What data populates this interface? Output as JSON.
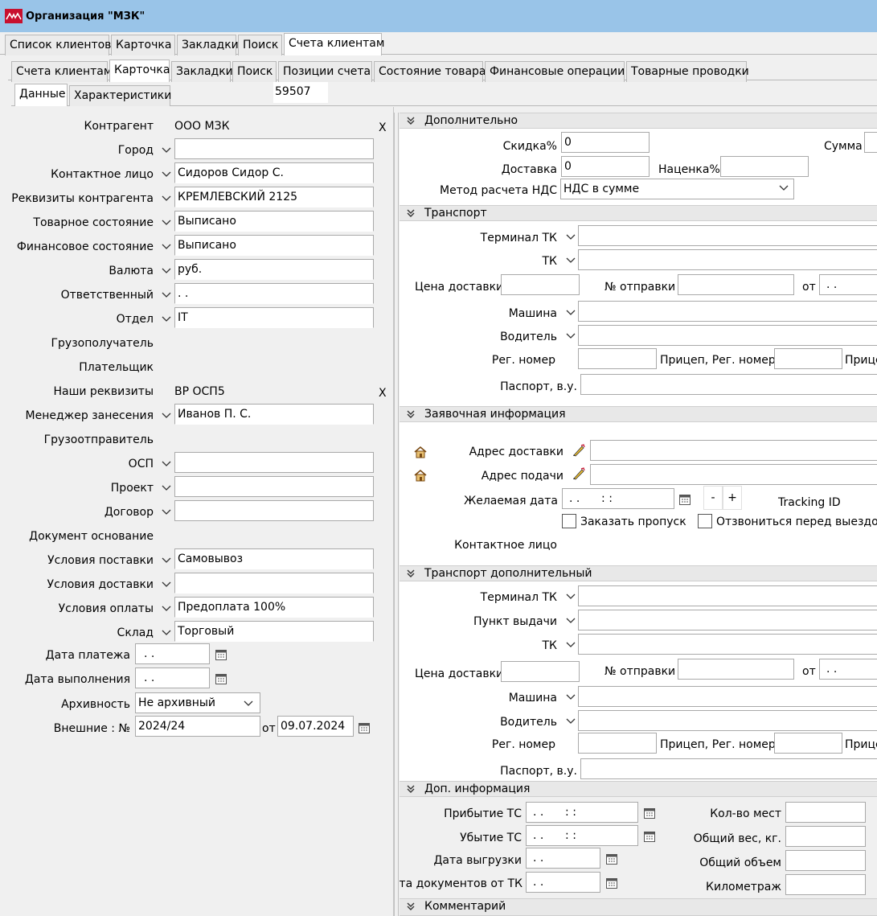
{
  "window": {
    "title": "Организация \"МЗК\""
  },
  "tabs_main": [
    "Список клиентов",
    "Карточка",
    "Закладки",
    "Поиск",
    "Счета клиентам"
  ],
  "tabs_sub": [
    "Счета клиентам",
    "Карточка",
    "Закладки",
    "Поиск",
    "Позиции счета",
    "Состояние товара",
    "Финансовые операции",
    "Товарные проводки"
  ],
  "tabs_inner": [
    "Данные",
    "Характеристики"
  ],
  "record_id": "59507",
  "left": {
    "kontragent_label": "Контрагент",
    "kontragent_value": "ООО МЗК",
    "kontragent_clear": "X",
    "gorod_label": "Город",
    "gorod_value": "",
    "contact_label": "Контактное лицо",
    "contact_value": "Сидоров Сидор С.",
    "rekv_label": "Реквизиты контрагента",
    "rekv_value": "КРЕМЛЕВСКИЙ 2125",
    "tov_label": "Товарное состояние",
    "tov_value": "Выписано",
    "fin_label": "Финансовое состояние",
    "fin_value": "Выписано",
    "val_label": "Валюта",
    "val_value": "руб.",
    "otv_label": "Ответственный",
    "otv_value": ". .",
    "otdel_label": "Отдел",
    "otdel_value": "IT",
    "gruzopol_label": "Грузополучатель",
    "plat_label": "Плательщик",
    "nashi_label": "Наши реквизиты",
    "nashi_value": "ВР ОСП5",
    "nashi_clear": "X",
    "manager_label": "Менеджер занесения",
    "manager_value": "Иванов П. С.",
    "gruzootpr_label": "Грузоотправитель",
    "osp_label": "ОСП",
    "osp_value": "",
    "proekt_label": "Проект",
    "proekt_value": "",
    "dogovor_label": "Договор",
    "dogovor_value": "",
    "doc_label": "Документ основание",
    "usl_post_label": "Условия поставки",
    "usl_post_value": "Самовывоз",
    "usl_dost_label": "Условия доставки",
    "usl_dost_value": "",
    "usl_opl_label": "Условия оплаты",
    "usl_opl_value": "Предоплата 100%",
    "sklad_label": "Склад",
    "sklad_value": "Торговый",
    "data_plat_label": "Дата платежа",
    "data_plat_value": ". .",
    "data_vyp_label": "Дата выполнения",
    "data_vyp_value": ". .",
    "arh_label": "Архивность",
    "arh_value": "Не архивный",
    "vnesh_label": "Внешние : №",
    "vnesh_value": "2024/24",
    "ot_label": "от",
    "ot_value": "09.07.2024"
  },
  "dop": {
    "title": "Дополнительно",
    "skidka_label": "Скидка%",
    "skidka_value": "0",
    "summa_label": "Сумма",
    "dostavka_label": "Доставка",
    "dostavka_value": "0",
    "nacenka_label": "Наценка%",
    "nacenka_value": "",
    "nds_label": "Метод расчета НДС",
    "nds_value": "НДС в сумме"
  },
  "transport": {
    "title": "Транспорт",
    "terminal_label": "Терминал ТК",
    "tk_label": "ТК",
    "cena_label": "Цена доставки",
    "otpr_label": "№ отправки",
    "ot_label": "от",
    "ot_value": ". .",
    "mashina_label": "Машина",
    "voditel_label": "Водитель",
    "reg_label": "Рег. номер",
    "pricep_label": "Прицеп, Рег. номер",
    "pricep2_label": "Прице",
    "pasport_label": "Паспорт, в.у."
  },
  "zayav": {
    "title": "Заявочная информация",
    "adres_dost_label": "Адрес доставки",
    "adres_pod_label": "Адрес подачи",
    "data_label": "Желаемая дата",
    "data_value": ". .      : :",
    "minus": "-",
    "plus": "+",
    "tracking_label": "Tracking ID",
    "propusk_label": "Заказать пропуск",
    "zvonok_label": "Отзвониться перед выездом",
    "contact_label": "Контактное лицо"
  },
  "transport2": {
    "title": "Транспорт дополнительный",
    "terminal_label": "Терминал ТК",
    "punkt_label": "Пункт выдачи",
    "tk_label": "ТК",
    "cena_label": "Цена доставки",
    "otpr_label": "№ отправки",
    "ot_label": "от",
    "ot_value": ". .",
    "mashina_label": "Машина",
    "voditel_label": "Водитель",
    "reg_label": "Рег. номер",
    "pricep_label": "Прицеп, Рег. номер",
    "pricep2_label": "Прице",
    "pasport_label": "Паспорт, в.у."
  },
  "dopinfo": {
    "title": "Доп. информация",
    "pribytie_label": "Прибытие ТС",
    "pribytie_value": ". .      : :",
    "ubytie_label": "Убытие ТС",
    "ubytie_value": ". .      : :",
    "vygruzka_label": "Дата выгрузки",
    "vygruzka_value": ". .",
    "docs_label": "ата документов от ТК",
    "docs_value": ". .",
    "mest_label": "Кол-во мест",
    "ves_label": "Общий вес, кг.",
    "obem_label": "Общий объем",
    "km_label": "Километраж"
  },
  "comment": {
    "title": "Комментарий"
  },
  "colors": {
    "titlebar": "#99c4e8",
    "accent_icon": "#c8102e"
  }
}
